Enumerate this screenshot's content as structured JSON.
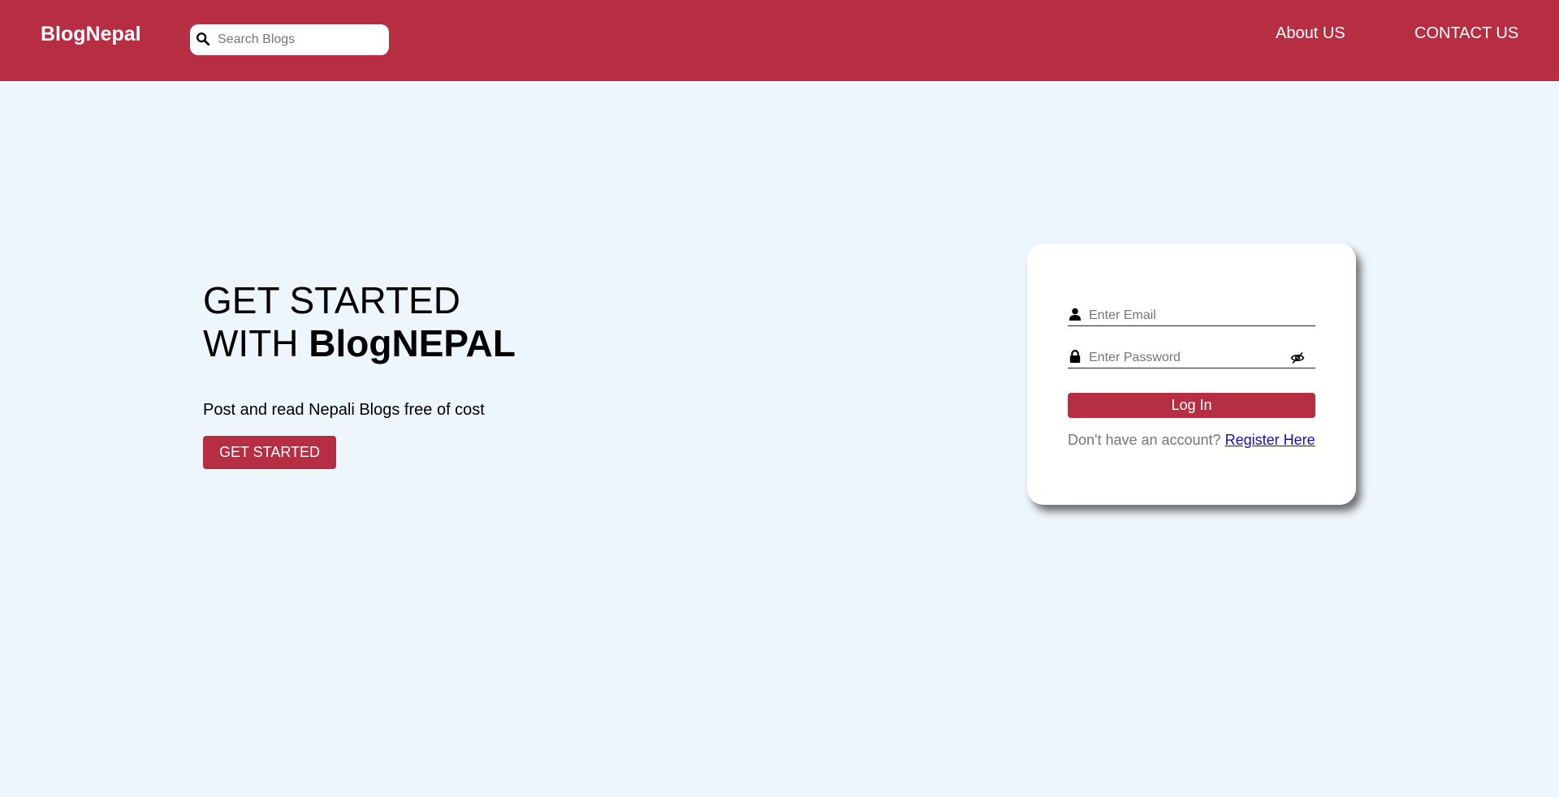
{
  "header": {
    "brand": "BlogNepal",
    "search_placeholder": "Search Blogs",
    "nav": {
      "about": "About US",
      "contact": "CONTACT US"
    }
  },
  "hero": {
    "title_line1": "GET STARTED",
    "title_line2_prefix": "WITH ",
    "title_line2_bold": "BlogNEPAL",
    "subtitle": "Post and read Nepali Blogs free of cost",
    "cta_label": "GET STARTED"
  },
  "login": {
    "email_placeholder": "Enter Email",
    "password_placeholder": "Enter Password",
    "submit_label": "Log In",
    "register_prompt": "Don't have an account? ",
    "register_link": "Register Here"
  },
  "icons": {
    "search": "search-icon",
    "user": "user-icon",
    "lock": "lock-icon",
    "eye_off": "eye-slash-icon"
  },
  "colors": {
    "brand": "#b72d42",
    "background": "#eef6fd",
    "card": "#ffffff",
    "link": "#1a0dab"
  }
}
